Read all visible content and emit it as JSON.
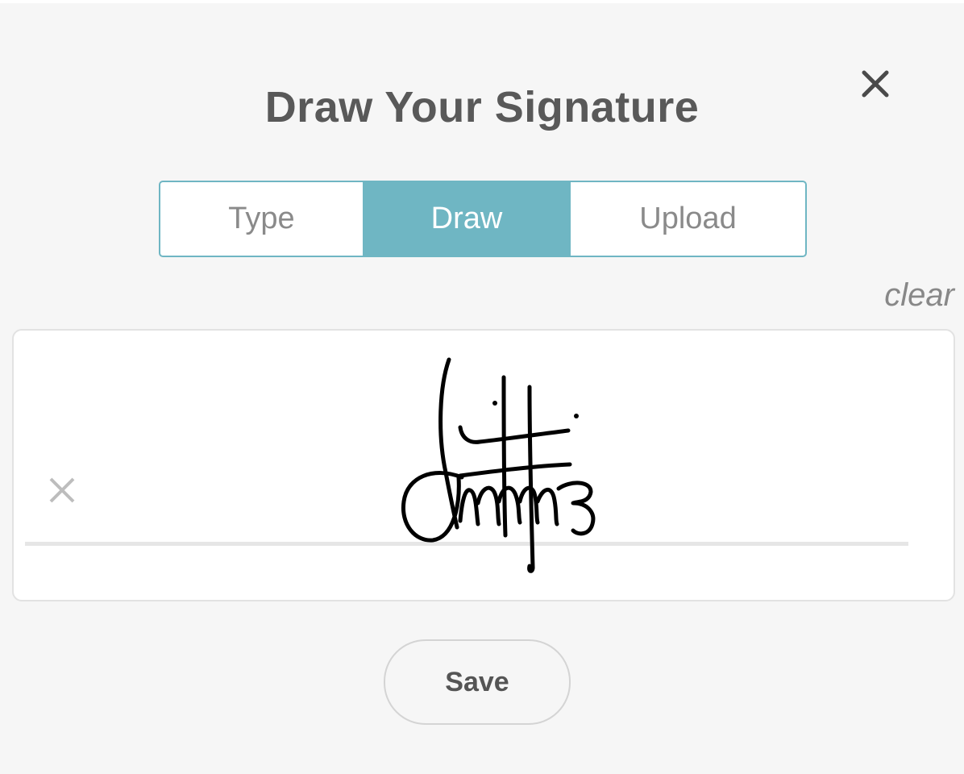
{
  "dialog": {
    "title": "Draw Your Signature",
    "close_icon": "close-icon"
  },
  "tabs": [
    {
      "label": "Type",
      "active": false
    },
    {
      "label": "Draw",
      "active": true
    },
    {
      "label": "Upload",
      "active": false
    }
  ],
  "pad": {
    "clear_label": "clear",
    "marker_icon": "x-mark-icon",
    "signature_present": true
  },
  "actions": {
    "save_label": "Save"
  },
  "colors": {
    "accent": "#6fb6c3",
    "title": "#595959",
    "background": "#f6f6f6"
  }
}
